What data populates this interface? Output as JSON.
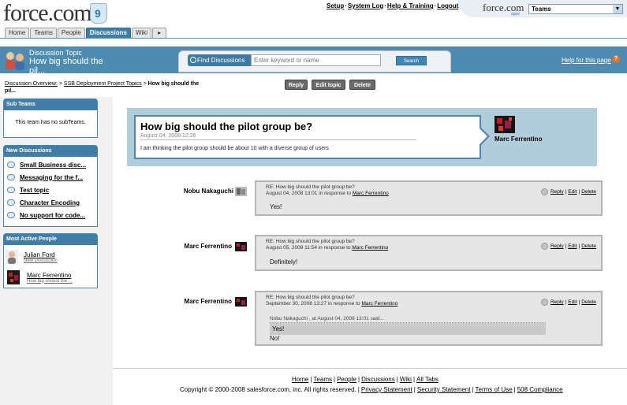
{
  "brand": {
    "logo_text": "force.com",
    "logo_badge": "9"
  },
  "top_links": [
    "Setup",
    "System Log",
    "Help & Training",
    "Logout"
  ],
  "app_logo": {
    "text": "force.com",
    "sub": "apps"
  },
  "app_select": {
    "value": "Teams"
  },
  "tabs": [
    {
      "label": "Home"
    },
    {
      "label": "Teams"
    },
    {
      "label": "People"
    },
    {
      "label": "Discussions",
      "active": true
    },
    {
      "label": "Wiki"
    },
    {
      "label": "▸"
    }
  ],
  "header": {
    "type": "Discussion Topic",
    "title": "How big should the pil..."
  },
  "search": {
    "button": "Find Discussions",
    "placeholder": "Enter keyword or name",
    "submit": "Search"
  },
  "help": {
    "label": "Help for this page",
    "icon": "?"
  },
  "breadcrumb": {
    "item1": "Discussion Overview:",
    "item2": "SSB Deployment Project Topics",
    "sep": ">",
    "current": "How big should the pil..."
  },
  "actions": {
    "reply": "Reply",
    "edit": "Edit topic",
    "delete": "Delete"
  },
  "sidebar": {
    "subteams": {
      "title": "Sub Teams",
      "text": "This team has no subTeams."
    },
    "new_discussions": {
      "title": "New Discussions",
      "items": [
        "Small Business disc...",
        "Messaging for the f...",
        "Test topic",
        "Character Encoding",
        "No support for code..."
      ]
    },
    "active_people": {
      "title": "Most Active People",
      "items": [
        {
          "name": "Julian Ford",
          "sub": "New Discussion"
        },
        {
          "name": "Marc Ferrentino",
          "sub": "How big should the ..."
        }
      ]
    }
  },
  "topic": {
    "title": "How big should the pilot group be?",
    "date": "August 04, 2008 12:26",
    "body": "I am thinking the pilot group should be about 10 with a diverse group of users",
    "author": "Marc Ferrentino"
  },
  "reply_links": {
    "reply": "Reply",
    "edit": "Edit",
    "delete": "Delete",
    "sep": "|"
  },
  "replies": [
    {
      "author": "Nobu Nakaguchi",
      "subject": "RE: How big should the pilot group be?",
      "meta": "August 04, 2008 13:01 in response to",
      "in_response_to": "Marc Ferrentino",
      "body": "Yes!"
    },
    {
      "author": "Marc Ferrentino",
      "subject": "RE: How big should the pilot group be?",
      "meta": "August 05, 2008 11:54 in response to",
      "in_response_to": "Marc Ferrentino",
      "body": "Definitely!"
    },
    {
      "author": "Marc Ferrentino",
      "subject": "RE: How big should the pilot group be?",
      "meta": "September 30, 2008 13:27 in response to",
      "in_response_to": "Marc Ferrentino",
      "quote_header": "Nobu Nakaguchi ,  at  August 04, 2008 13:01 said...",
      "quote": "Yes!",
      "body": "No!"
    }
  ],
  "footer": {
    "links": [
      "Home",
      "Teams",
      "People",
      "Discussions",
      "Wiki",
      "All Tabs"
    ],
    "copyright": "Copyright © 2000-2008 salesforce.com, inc. All rights reserved.",
    "legal": [
      "Privacy Statement",
      "Security Statement",
      "Terms of Use",
      "508 Compliance"
    ]
  },
  "colors": {
    "accent": "#3e7ea7",
    "band": "#4d8cb0",
    "panel": "#b0cdd9"
  }
}
